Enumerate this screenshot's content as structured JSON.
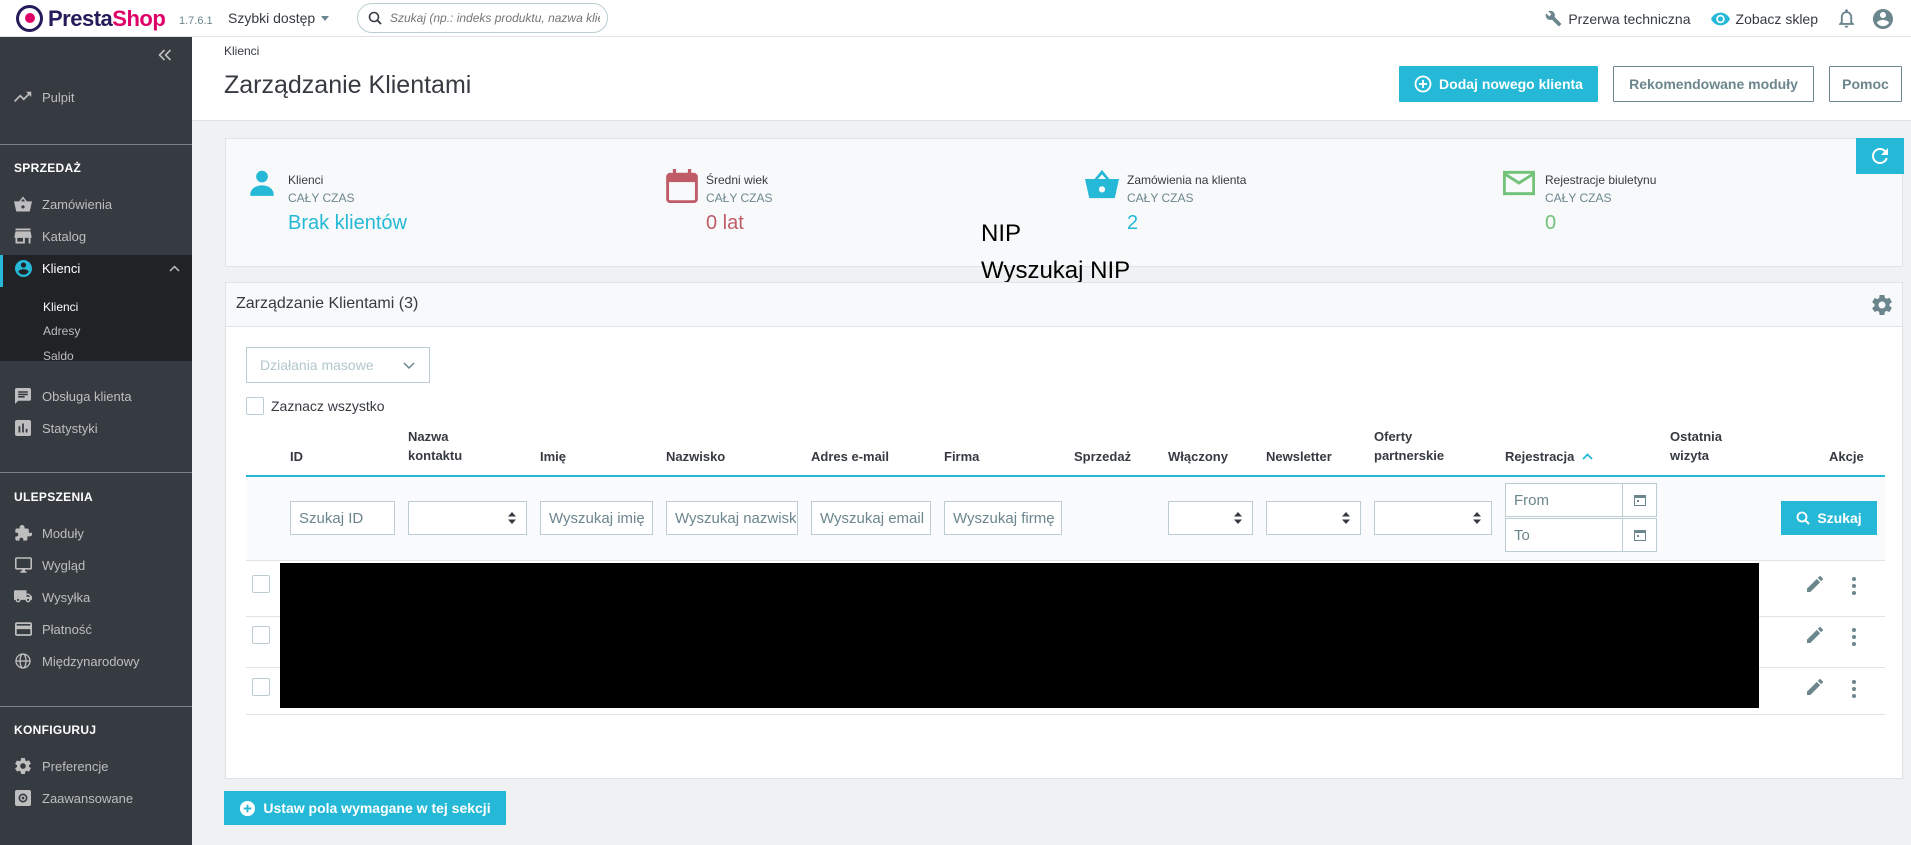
{
  "header": {
    "logo": {
      "presta": "Presta",
      "shop": "Shop"
    },
    "version": "1.7.6.1",
    "quick_access": "Szybki dostęp",
    "search_placeholder": "Szukaj (np.: indeks produktu, nazwa klienta...)",
    "maintenance": "Przerwa techniczna",
    "view_shop": "Zobacz sklep"
  },
  "sidebar": {
    "dashboard": "Pulpit",
    "sections": [
      {
        "title": "SPRZEDAŻ",
        "items": [
          "Zamówienia",
          "Katalog",
          "Klienci"
        ]
      },
      {
        "title": "",
        "items": [
          "Obsługa klienta",
          "Statystyki"
        ]
      },
      {
        "title": "ULEPSZENIA",
        "items": [
          "Moduły",
          "Wygląd",
          "Wysyłka",
          "Płatność",
          "Międzynarodowy"
        ]
      },
      {
        "title": "KONFIGURUJ",
        "items": [
          "Preferencje",
          "Zaawansowane"
        ]
      }
    ],
    "submenu": [
      "Klienci",
      "Adresy",
      "Saldo"
    ]
  },
  "page": {
    "breadcrumb": "Klienci",
    "title": "Zarządzanie Klientami",
    "buttons": {
      "add": "Dodaj nowego klienta",
      "recommended": "Rekomendowane moduły",
      "help": "Pomoc"
    }
  },
  "kpis": [
    {
      "title": "Klienci",
      "sub": "CAŁY CZAS",
      "value": "Brak klientów",
      "color": "#25b9d7",
      "icon": "user-icon"
    },
    {
      "title": "Średni wiek",
      "sub": "CAŁY CZAS",
      "value": "0 lat",
      "color": "#c05c67",
      "icon": "calendar-icon"
    },
    {
      "title": "Zamówienia na klienta",
      "sub": "CAŁY CZAS",
      "value": "2",
      "color": "#25b9d7",
      "icon": "basket-icon"
    },
    {
      "title": "Rejestracje biuletynu",
      "sub": "CAŁY CZAS",
      "value": "0",
      "color": "#72c279",
      "icon": "mail-icon"
    }
  ],
  "annotation": {
    "line1": "NIP",
    "line2": "Wyszukaj NIP"
  },
  "list": {
    "title": "Zarządzanie Klientami (3)",
    "bulk_actions": "Działania masowe",
    "select_all": "Zaznacz wszystko",
    "columns": {
      "id": "ID",
      "contact_name_1": "Nazwa",
      "contact_name_2": "kontaktu",
      "first_name": "Imię",
      "last_name": "Nazwisko",
      "email": "Adres e-mail",
      "company": "Firma",
      "sales": "Sprzedaż",
      "enabled": "Włączony",
      "newsletter": "Newsletter",
      "partner_1": "Oferty",
      "partner_2": "partnerskie",
      "registration": "Rejestracja",
      "last_visit_1": "Ostatnia",
      "last_visit_2": "wizyta",
      "actions": "Akcje"
    },
    "filters": {
      "id": "Szukaj ID",
      "first_name": "Wyszukaj imię",
      "last_name": "Wyszukaj nazwisko",
      "email": "Wyszukaj email",
      "company": "Wyszukaj firmę",
      "date_from": "From",
      "date_to": "To",
      "search_button": "Szukaj"
    },
    "row_count": 3
  },
  "footer_button": "Ustaw pola wymagane w tej sekcji"
}
